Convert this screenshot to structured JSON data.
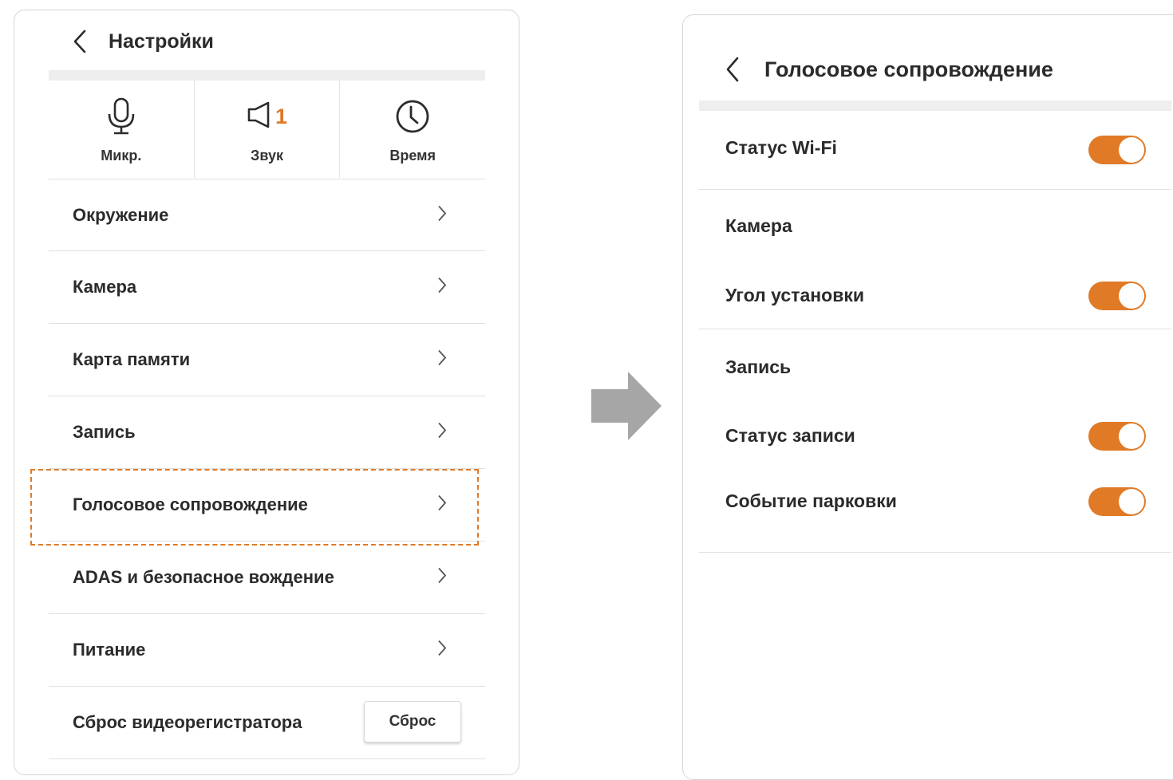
{
  "left": {
    "title": "Настройки",
    "quick": [
      {
        "icon": "microphone-icon",
        "label": "Микр."
      },
      {
        "icon": "speaker-icon",
        "label": "Звук",
        "badge": "1"
      },
      {
        "icon": "clock-icon",
        "label": "Время"
      }
    ],
    "items": [
      {
        "label": "Окружение"
      },
      {
        "label": "Камера"
      },
      {
        "label": "Карта памяти"
      },
      {
        "label": "Запись"
      },
      {
        "label": "Голосовое сопровождение"
      },
      {
        "label": "ADAS и безопасное вождение"
      },
      {
        "label": "Питание"
      }
    ],
    "reset": {
      "label": "Сброс видеорегистратора",
      "button": "Сброс"
    }
  },
  "right": {
    "title": "Голосовое сопровождение",
    "wifi": {
      "label": "Статус Wi-Fi",
      "on": true
    },
    "camera_section": "Камера",
    "angle": {
      "label": "Угол установки",
      "on": true
    },
    "record_section": "Запись",
    "record_status": {
      "label": "Статус записи",
      "on": true
    },
    "parking": {
      "label": "Событие парковки",
      "on": true
    }
  },
  "colors": {
    "accent": "#e07a26",
    "arrow": "#a6a6a6",
    "divider": "#e0e0e0"
  }
}
